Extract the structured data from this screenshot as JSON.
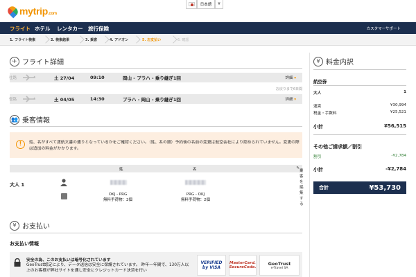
{
  "header": {
    "brand": "mytrip",
    "brand_suffix": ".com",
    "language": "日本語",
    "currency": "¥"
  },
  "nav": {
    "items": [
      "フライト",
      "ホテル",
      "レンタカー",
      "旅行保険"
    ],
    "support": "カスタマーサポート"
  },
  "steps": [
    "1. フライト検索",
    "2. 検索結果",
    "3. 乗客",
    "4. アドオン",
    "5. お支払い",
    "6. 確認"
  ],
  "flight": {
    "title": "フライト詳細",
    "outbound": {
      "label": "往路",
      "date": "土 27/04",
      "time": "09:10",
      "route": "岡山 - プラハ - 乗り継ぎ1回",
      "detail": "詳細"
    },
    "remaining": "お戻りまで6日間",
    "inbound": {
      "label": "復路",
      "date": "土 04/05",
      "time": "14:30",
      "route": "プラハ - 岡山 - 乗り継ぎ1回",
      "detail": "詳細"
    }
  },
  "passengers": {
    "title": "乗客情報",
    "notice": "姓、名がすべて渡航文書の通りとなっているかをご確認ください。（姓、名の順）予約後の名前の変更は航空会社により認められていません。変更の際は追加の料金がかかります。",
    "col_last": "姓",
    "col_first": "名",
    "edit": "乗客を編集する",
    "adult_label": "大人 1",
    "bag_out_route": "OKJ - PRG",
    "bag_out_allowance": "無料手荷物：2個",
    "bag_in_route": "PRG - OKJ",
    "bag_in_allowance": "無料手荷物：2個"
  },
  "payment": {
    "title": "お支払い",
    "info_title": "お支払い情報",
    "secure_title": "安全の為、このお支払いは暗号化されています",
    "secure_text": "GeoTrust認定により、データ送信は安全に保護されています。 昨年一年間で、130万人以上のお客様が弊社サイトを通し安全にクレジットカード決済を行い",
    "badge_visa_1": "VERIFIED",
    "badge_visa_2": "by VISA",
    "badge_mc_1": "MasterCard.",
    "badge_mc_2": "SecureCode.",
    "badge_geo_1": "GeoTrust",
    "badge_geo_2": "e-Travel SA"
  },
  "summary": {
    "title": "料金内訳",
    "ticket_title": "航空券",
    "adult_label": "大人",
    "adult_count": "1",
    "fare_label": "運賃",
    "fare_value": "¥30,994",
    "tax_label": "税金・手数料",
    "tax_value": "¥25,521",
    "subtotal_label": "小計",
    "subtotal_value": "¥56,515",
    "other_title": "その他ご請求額／割引",
    "discount_label": "割引",
    "discount_value": "-¥2,784",
    "subtotal2_label": "小計",
    "subtotal2_value": "-¥2,784",
    "total_label": "合計",
    "total_value": "¥53,730"
  },
  "colors": {
    "nav_bg": "#1c2f4f",
    "accent": "#f29400",
    "discount": "#2e7d32"
  }
}
